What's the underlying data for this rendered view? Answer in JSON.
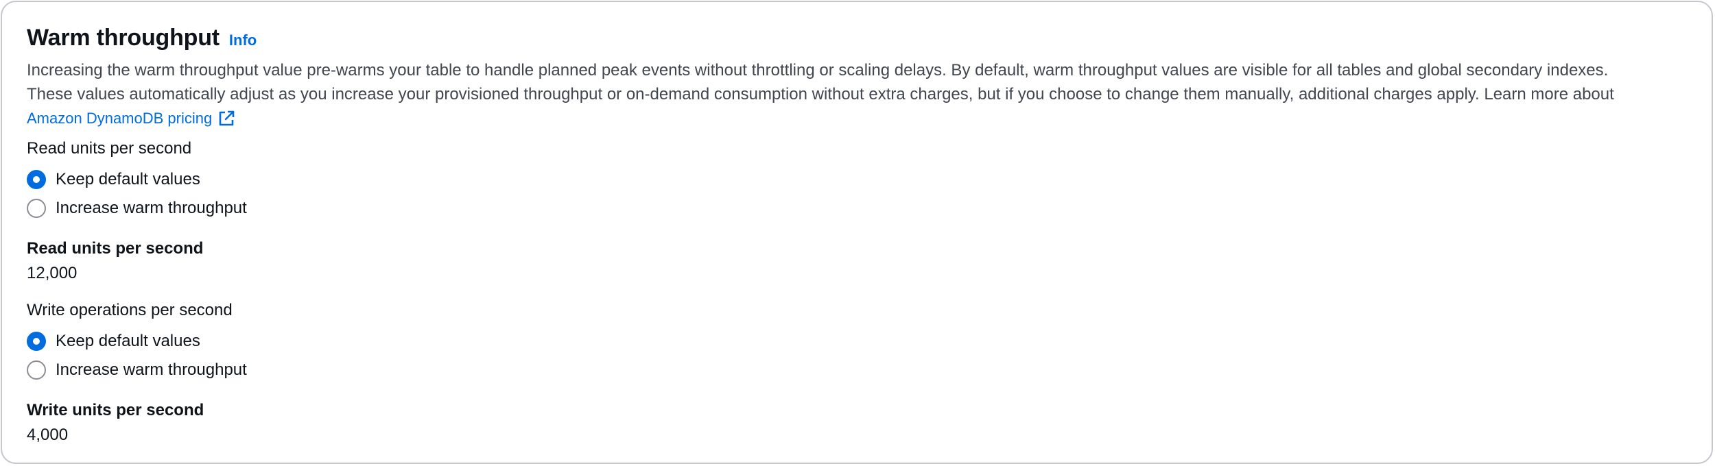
{
  "panel": {
    "title": "Warm throughput",
    "info_link": "Info",
    "description_line1": "Increasing the warm throughput value pre-warms your table to handle planned peak events without throttling or scaling delays. By default, warm throughput values are visible for all tables and global secondary indexes.",
    "description_line2": "These values automatically adjust as you increase your provisioned throughput or on-demand consumption without extra charges, but if you choose to change them manually, additional charges apply. Learn more about",
    "pricing_link": "Amazon DynamoDB pricing",
    "pricing_link_icon": "external-link-icon"
  },
  "read": {
    "group_label": "Read units per second",
    "options": [
      {
        "label": "Keep default values",
        "selected": true
      },
      {
        "label": "Increase warm throughput",
        "selected": false
      }
    ],
    "value_key": "Read units per second",
    "value": "12,000"
  },
  "write": {
    "group_label": "Write operations per second",
    "options": [
      {
        "label": "Keep default values",
        "selected": true
      },
      {
        "label": "Increase warm throughput",
        "selected": false
      }
    ],
    "value_key": "Write units per second",
    "value": "4,000"
  },
  "colors": {
    "accent": "#006ce0",
    "border": "#c6c6cd",
    "text": "#0f141a",
    "muted_text": "#424650"
  }
}
